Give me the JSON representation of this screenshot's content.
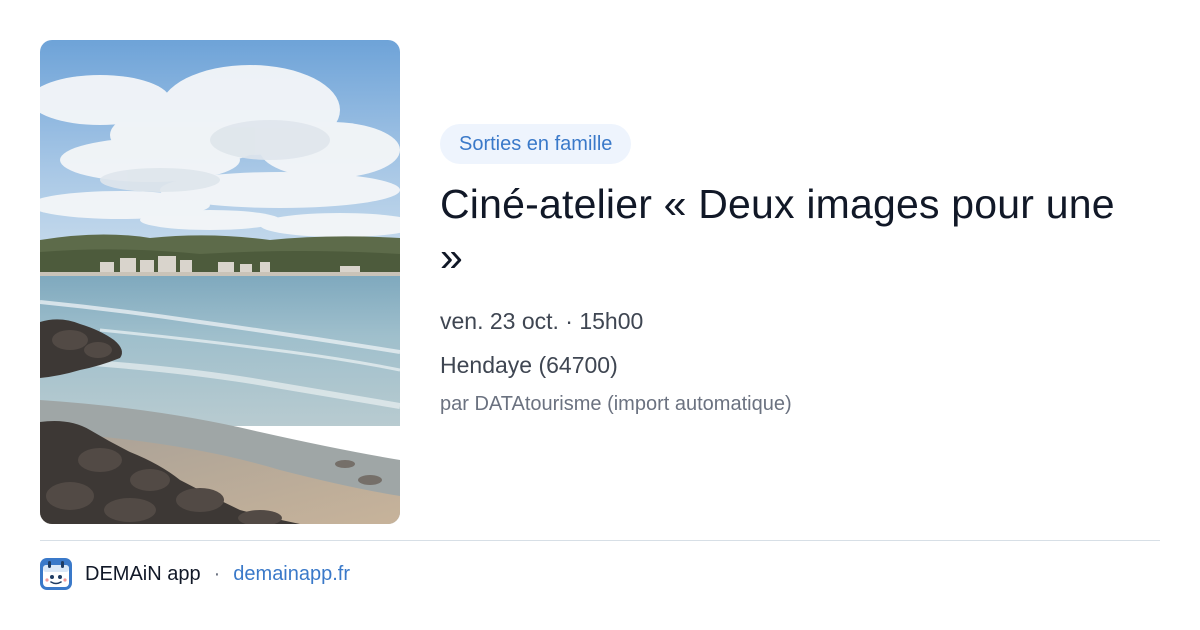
{
  "event": {
    "category": "Sorties en famille",
    "title": "Ciné-atelier « Deux images pour une »",
    "date": "ven. 23 oct. · 15h00",
    "location": "Hendaye (64700)",
    "source": "par DATAtourisme (import automatique)"
  },
  "footer": {
    "app_name": "DEMAiN app",
    "separator": "·",
    "link": "demainapp.fr"
  },
  "colors": {
    "accent": "#3a79c9",
    "tag_bg": "#eef4fd",
    "text": "#111827",
    "muted": "#6b7280"
  }
}
